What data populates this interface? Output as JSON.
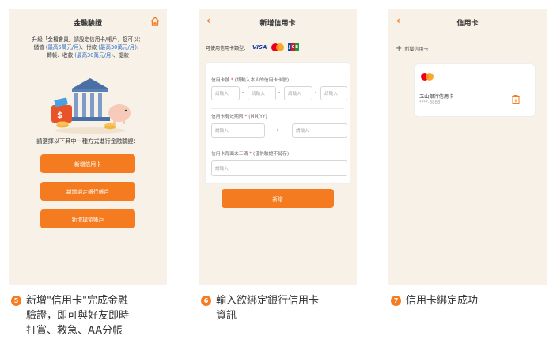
{
  "screen1": {
    "title": "金融驗證",
    "intro_line1": "升級「金檔會員」請設定信用卡/帳戶，您可以：",
    "intro_line2a": "儲值 ",
    "intro_line2b": "(最高5萬元/月)",
    "intro_line2c": "、付款 ",
    "intro_line2d": "(最高30萬元/月)",
    "intro_line2e": "、",
    "intro_line3a": "轉帳、收款 ",
    "intro_line3b": "(最高30萬元/月)",
    "intro_line3c": "、提款",
    "choose_text": "請選擇以下其中一種方式進行金融驗證：",
    "btn_credit": "新增信用卡",
    "btn_bank": "新增綁定銀行帳戶",
    "btn_collect": "新增提領帳戶"
  },
  "screen2": {
    "title": "新增信用卡",
    "card_types_label": "可使用信用卡類型：",
    "visa": "VISA",
    "card_number_label": "信用卡號",
    "card_number_hint": "(請輸入本人的信用卡卡號)",
    "placeholder": "請輸入",
    "expiry_label": "信用卡有效期限",
    "expiry_hint": "(MM/YY)",
    "slash": "/",
    "cvv_label": "信用卡背面末三碼",
    "cvv_hint": "(僅供驗證不儲存)",
    "dash": "-",
    "add_button": "新增"
  },
  "screen3": {
    "title": "信用卡",
    "add_card": "新增信用卡",
    "card_name": "玉山銀行信用卡",
    "card_number": "****-8888"
  },
  "captions": {
    "c5_num": "5",
    "c5_line1": "新增\"信用卡\"完成金融",
    "c5_line2": "驗證，即可與好友即時",
    "c5_line3": "打賞、救急、AA分帳",
    "c6_num": "6",
    "c6_line1": "輸入欲綁定銀行信用卡",
    "c6_line2": "資訊",
    "c7_num": "7",
    "c7_line1": "信用卡綁定成功"
  },
  "colors": {
    "accent": "#f47b20",
    "phone_bg": "#f7f1e8",
    "link_blue": "#2e6fc9"
  }
}
